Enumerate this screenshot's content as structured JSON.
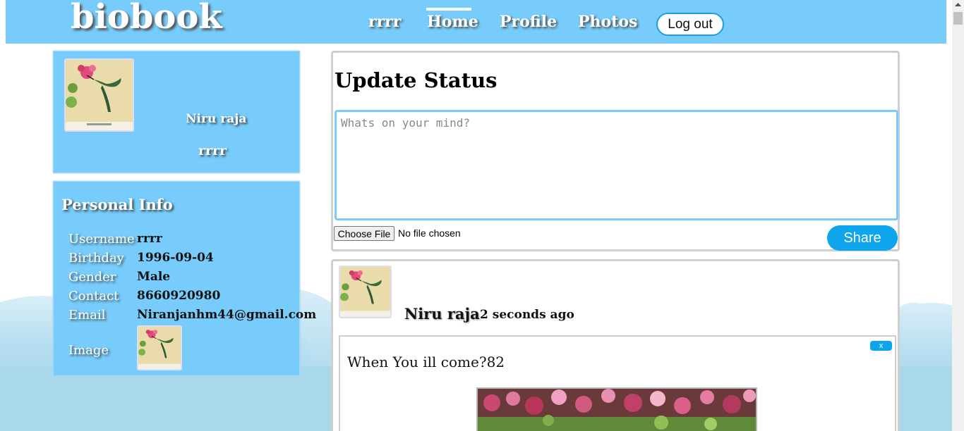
{
  "header": {
    "logo": "biobook",
    "nav": {
      "user": "rrrr",
      "home": "Home",
      "profile": "Profile",
      "photos": "Photos"
    },
    "logout_label": "Log out"
  },
  "profile_card": {
    "display_name": "Niru raja",
    "username": "rrrr"
  },
  "personal_info": {
    "title": "Personal Info",
    "rows": [
      {
        "label": "Username",
        "value": "rrrr"
      },
      {
        "label": "Birthday",
        "value": "1996-09-04"
      },
      {
        "label": "Gender",
        "value": "Male"
      },
      {
        "label": "Contact",
        "value": "8660920980"
      },
      {
        "label": "Email",
        "value": "Niranjanhm44@gmail.com"
      }
    ],
    "image_label": "Image"
  },
  "status": {
    "title": "Update Status",
    "placeholder": "Whats on your mind?",
    "file_button": "Choose File",
    "file_status": "No file chosen",
    "share_label": "Share"
  },
  "post": {
    "author": "Niru raja",
    "time": "2 seconds ago",
    "text": "When You ill come?82",
    "close_label": "x"
  },
  "colors": {
    "header_bg": "#77ccfb",
    "card_bg": "#77ccfb",
    "accent_button": "#0ea5ec"
  },
  "icons": {
    "avatar": "hummingbird-photo",
    "scroll": "scroll-up-arrow-icon"
  }
}
